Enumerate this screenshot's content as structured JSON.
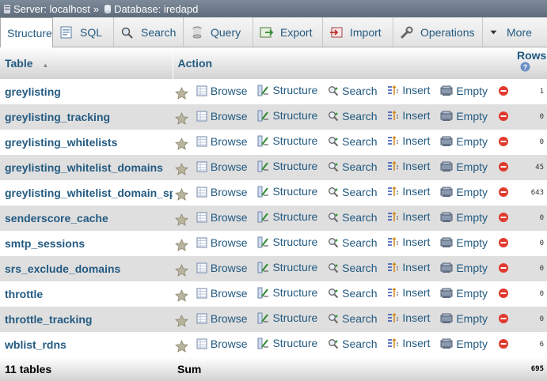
{
  "breadcrumb": {
    "server": "Server: localhost",
    "separator": "»",
    "database": "Database: iredapd"
  },
  "tabs": [
    {
      "label": "Structure",
      "icon": "structure-icon",
      "active": true
    },
    {
      "label": "SQL",
      "icon": "sql-icon"
    },
    {
      "label": "Search",
      "icon": "search-icon"
    },
    {
      "label": "Query",
      "icon": "query-icon"
    },
    {
      "label": "Export",
      "icon": "export-icon"
    },
    {
      "label": "Import",
      "icon": "import-icon"
    },
    {
      "label": "Operations",
      "icon": "wrench-icon"
    },
    {
      "label": "More",
      "icon": "chevron-down-icon"
    }
  ],
  "table": {
    "headers": {
      "table": "Table",
      "sort_indicator": "▲",
      "action": "Action",
      "rows": "Rows"
    },
    "actions": [
      "Browse",
      "Structure",
      "Search",
      "Insert",
      "Empty",
      "Drop"
    ],
    "rows": [
      {
        "name": "greylisting",
        "rows": "1"
      },
      {
        "name": "greylisting_tracking",
        "rows": "0"
      },
      {
        "name": "greylisting_whitelists",
        "rows": "0"
      },
      {
        "name": "greylisting_whitelist_domains",
        "rows": "45"
      },
      {
        "name": "greylisting_whitelist_domain_spf",
        "rows": "643"
      },
      {
        "name": "senderscore_cache",
        "rows": "0"
      },
      {
        "name": "smtp_sessions",
        "rows": "0"
      },
      {
        "name": "srs_exclude_domains",
        "rows": "0"
      },
      {
        "name": "throttle",
        "rows": "0"
      },
      {
        "name": "throttle_tracking",
        "rows": "0"
      },
      {
        "name": "wblist_rdns",
        "rows": "6"
      }
    ],
    "footer": {
      "count": "11 tables",
      "sum_label": "Sum",
      "total": "695"
    }
  },
  "colors": {
    "link": "#235a81",
    "row_alt": "#dfdfdf",
    "breadcrumb_bg": "#6d7a8a",
    "drop_red": "#e03a2e"
  }
}
